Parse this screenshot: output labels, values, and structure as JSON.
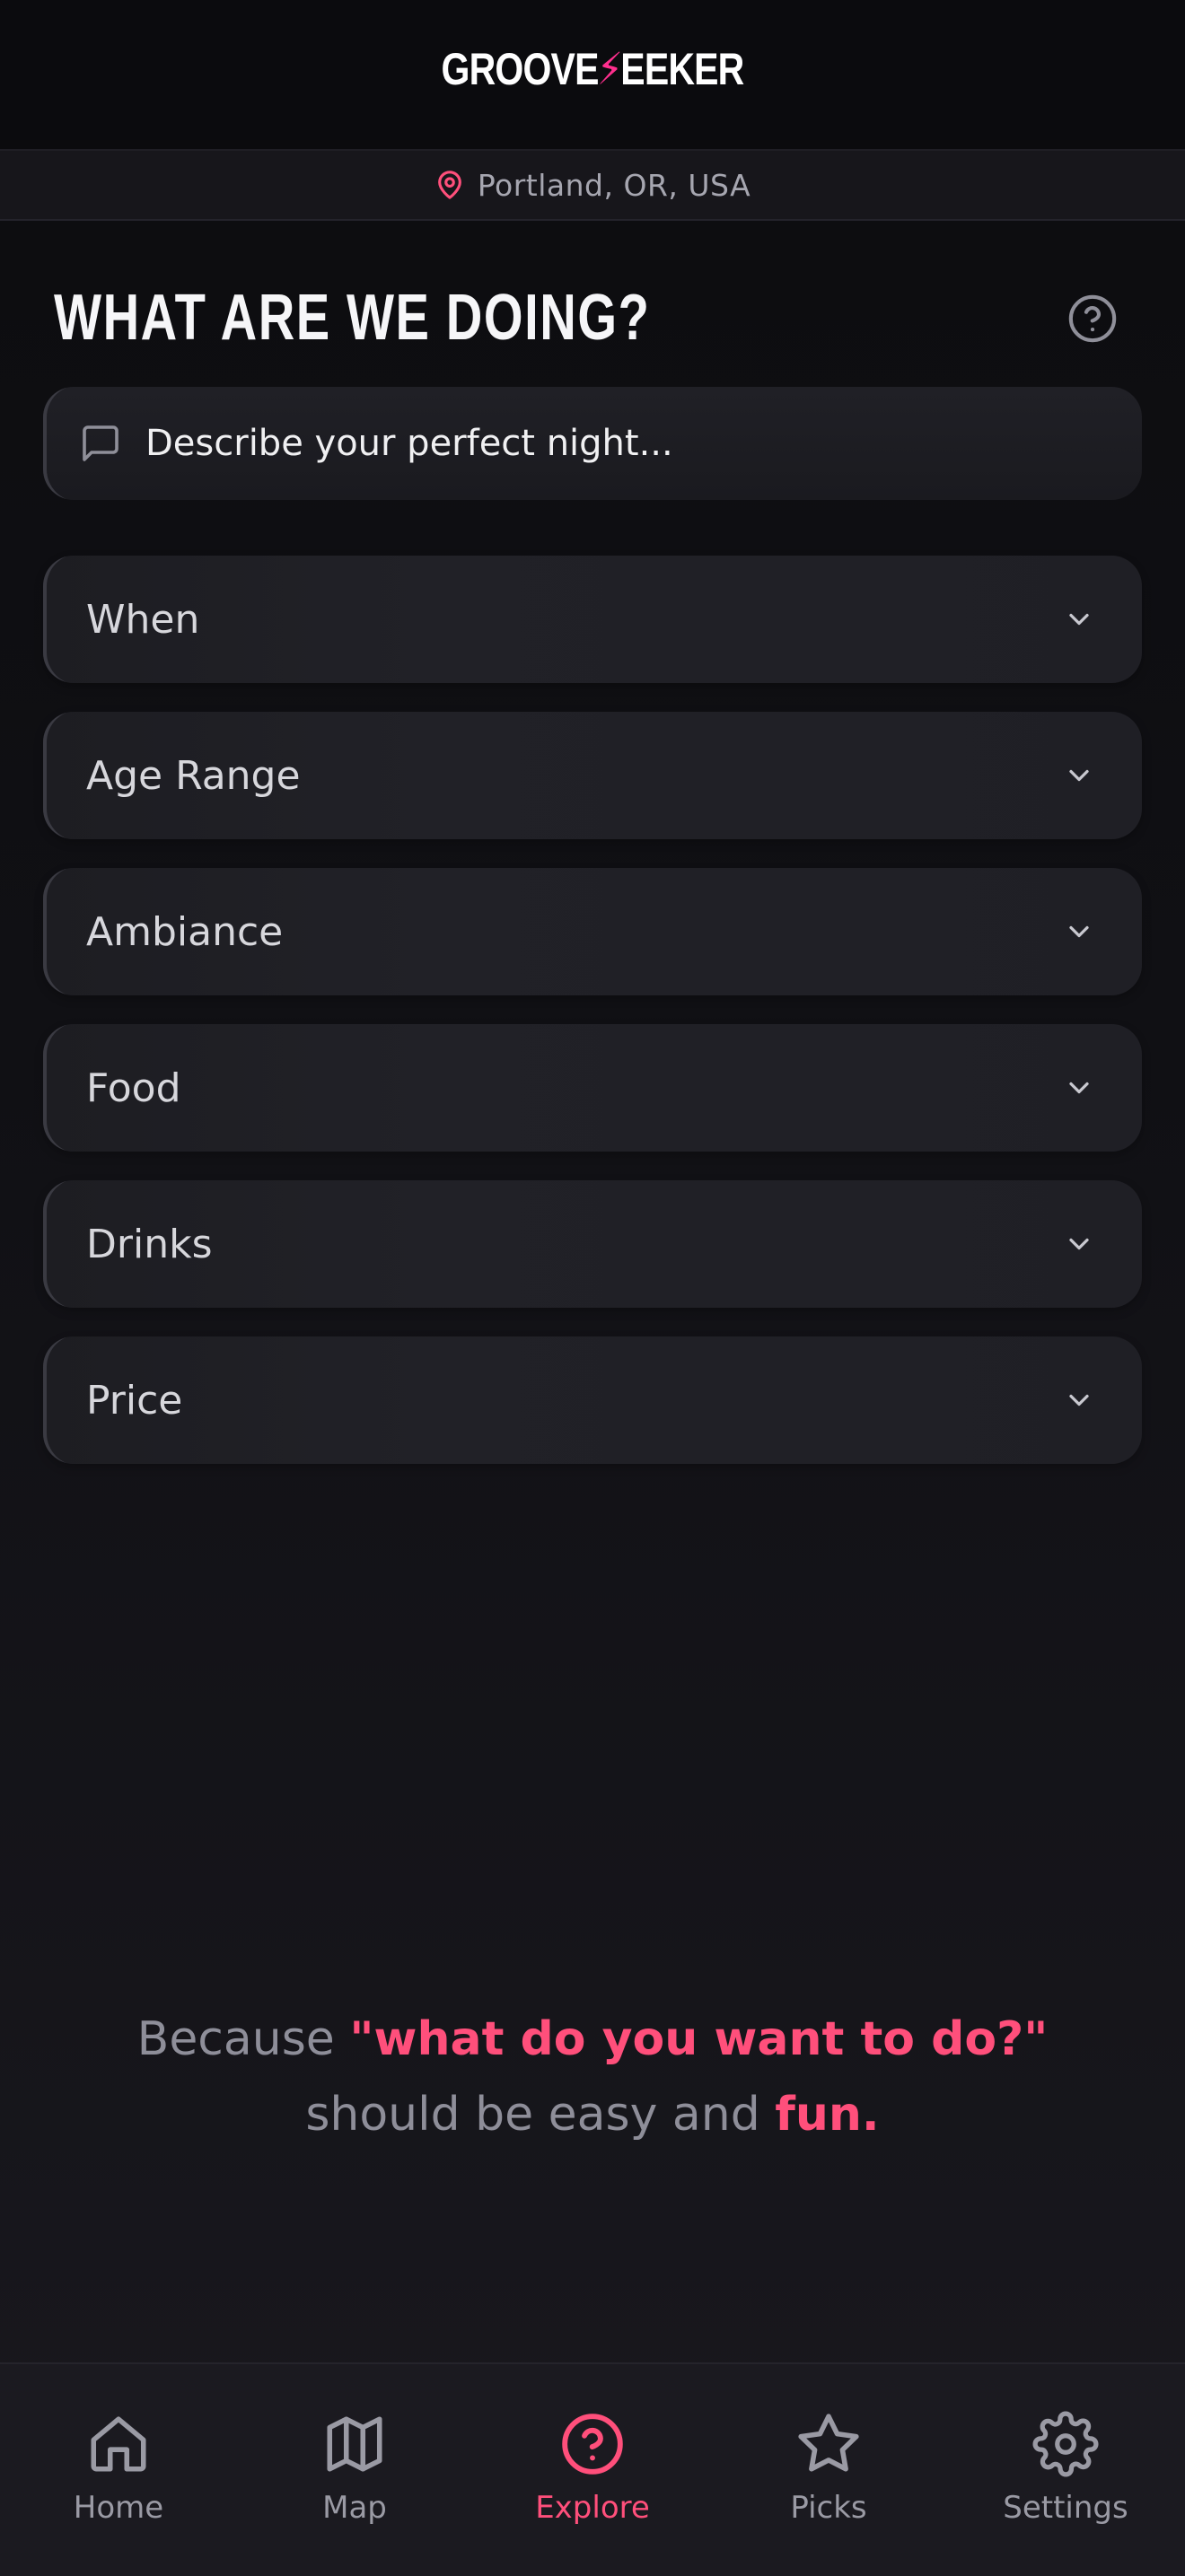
{
  "app": {
    "logo_left": "GROOVE",
    "logo_bolt": "⚡",
    "logo_right": "EEKER",
    "accent_color": "#ff4f7b"
  },
  "location": {
    "text": "Portland, OR, USA",
    "icon": "map-pin-icon"
  },
  "page": {
    "title": "WHAT ARE WE DOING?",
    "help_icon": "question-circle-icon"
  },
  "describe": {
    "placeholder": "Describe your perfect night...",
    "value": "",
    "icon": "chat-bubble-icon"
  },
  "filters": [
    {
      "label": "When"
    },
    {
      "label": "Age Range"
    },
    {
      "label": "Ambiance"
    },
    {
      "label": "Food"
    },
    {
      "label": "Drinks"
    },
    {
      "label": "Price"
    }
  ],
  "tagline": {
    "part1": "Because ",
    "accent1": "\"what do you want to do?\"",
    "part2": " should be easy and ",
    "accent2": "fun."
  },
  "nav": {
    "items": [
      {
        "label": "Home",
        "icon": "home-icon",
        "active": false
      },
      {
        "label": "Map",
        "icon": "map-icon",
        "active": false
      },
      {
        "label": "Explore",
        "icon": "question-circle-icon",
        "active": true
      },
      {
        "label": "Picks",
        "icon": "star-icon",
        "active": false
      },
      {
        "label": "Settings",
        "icon": "gear-icon",
        "active": false
      }
    ]
  }
}
